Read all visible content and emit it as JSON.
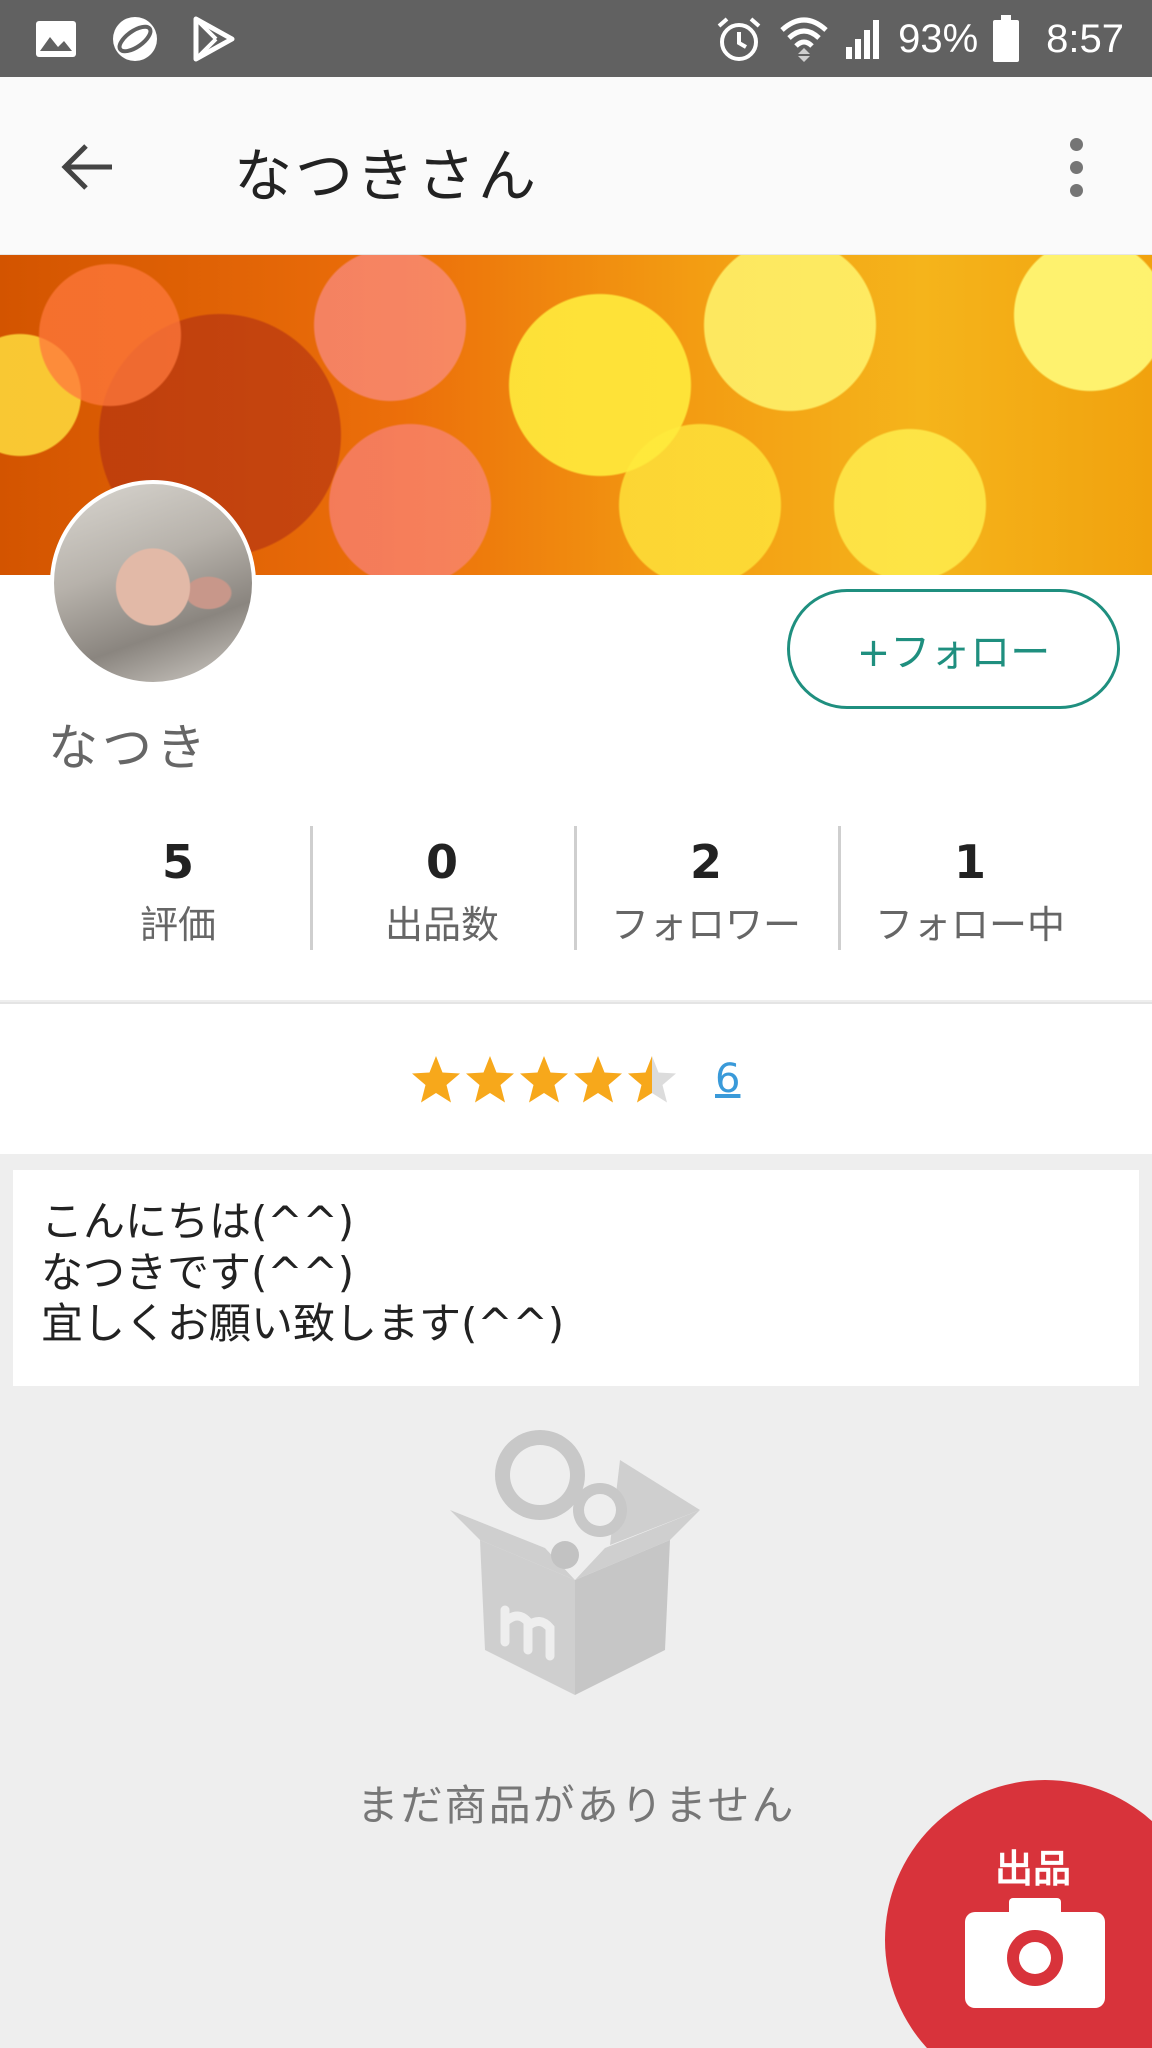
{
  "status_bar": {
    "battery": "93%",
    "time": "8:57",
    "icons": [
      "image-icon",
      "ring-icon",
      "play-store-icon",
      "alarm-icon",
      "wifi-icon",
      "signal-icon",
      "battery-icon"
    ]
  },
  "app_bar": {
    "title": "なつきさん",
    "back_icon": "arrow-back-icon",
    "menu_icon": "more-vert-icon"
  },
  "profile": {
    "name": "なつき",
    "follow_label": "+フォロー",
    "accent_color": "#1f8f7f"
  },
  "stats": [
    {
      "value": "5",
      "label": "評価"
    },
    {
      "value": "0",
      "label": "出品数"
    },
    {
      "value": "2",
      "label": "フォロワー"
    },
    {
      "value": "1",
      "label": "フォロー中"
    }
  ],
  "rating": {
    "stars": 4.5,
    "max": 5,
    "count": "6",
    "star_color": "#f7a81b"
  },
  "bio": {
    "lines": [
      "こんにちは(^^)",
      "なつきです(^^)",
      "宜しくお願い致します(^^)"
    ]
  },
  "empty_state": {
    "icon": "empty-box-icon",
    "message": "まだ商品がありません"
  },
  "fab": {
    "label": "出品",
    "icon": "camera-icon",
    "color": "#d8333b"
  }
}
